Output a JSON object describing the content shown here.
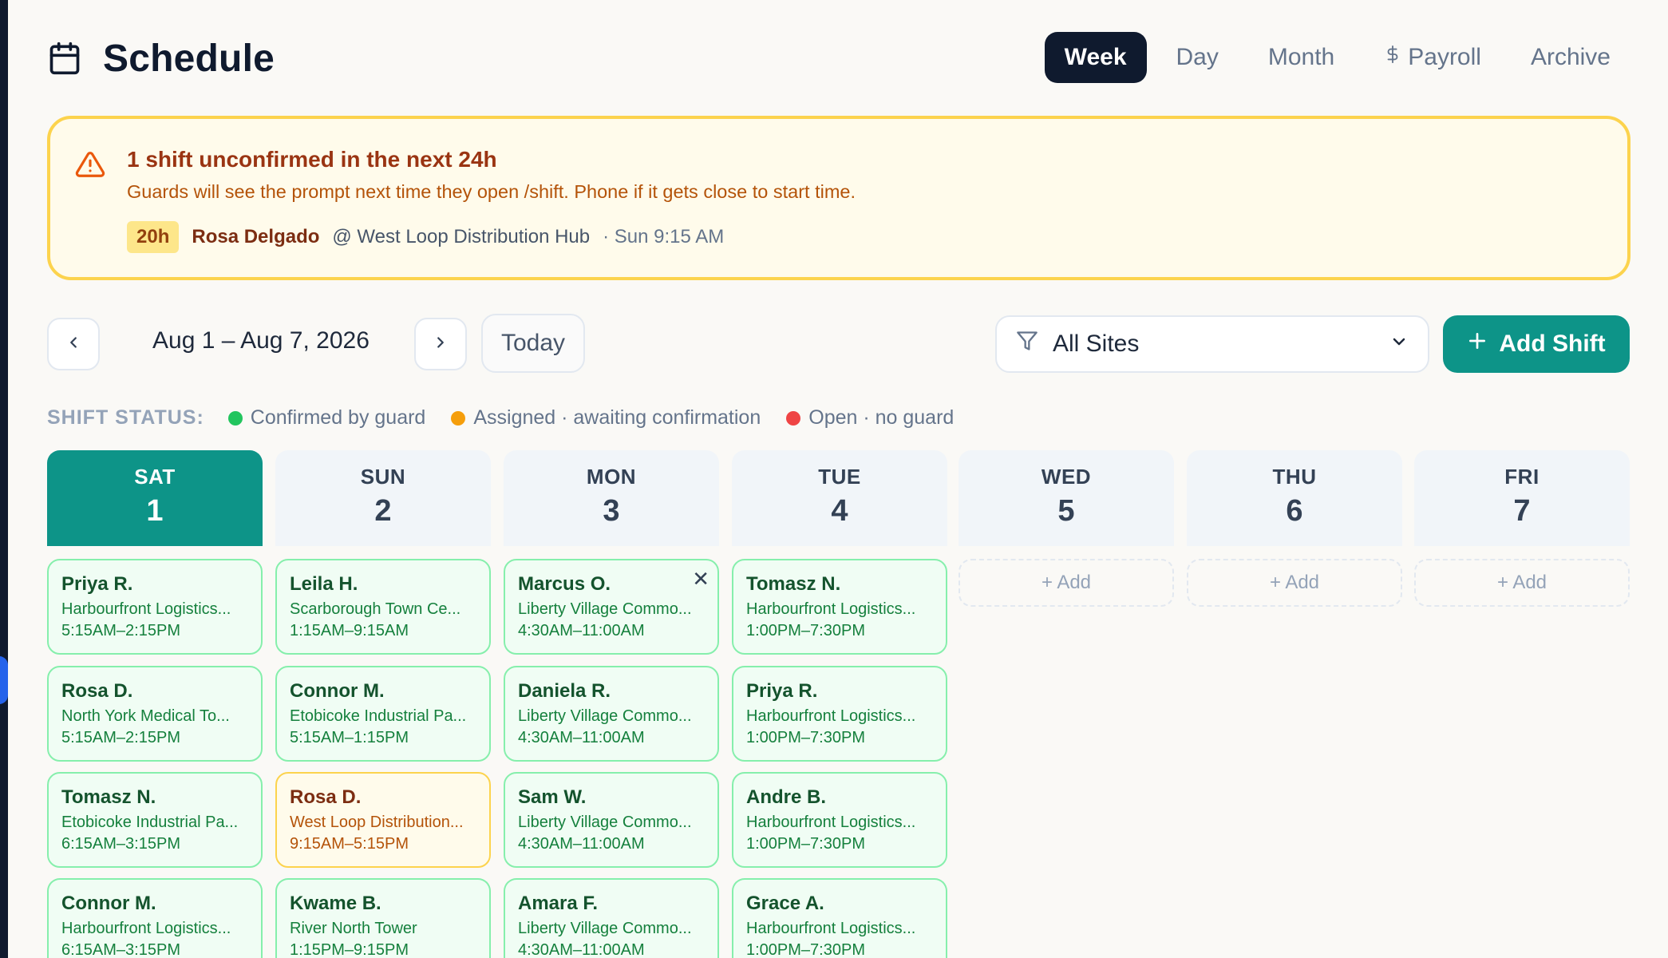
{
  "header": {
    "title": "Schedule",
    "tabs": [
      {
        "label": "Week",
        "active": true
      },
      {
        "label": "Day"
      },
      {
        "label": "Month"
      },
      {
        "label": "Payroll",
        "icon": "dollar-icon"
      },
      {
        "label": "Archive"
      }
    ]
  },
  "alert": {
    "title": "1 shift unconfirmed in the next 24h",
    "text": "Guards will see the prompt next time they open /shift. Phone if it gets close to start time.",
    "badge": "20h",
    "name": "Rosa Delgado",
    "site": "@ West Loop Distribution Hub",
    "time": "· Sun 9:15 AM"
  },
  "toolbar": {
    "range": "Aug 1 – Aug 7, 2026",
    "today_label": "Today",
    "site_filter": "All Sites",
    "add_label": "Add Shift"
  },
  "legend": {
    "title": "SHIFT STATUS:",
    "items": [
      {
        "label": "Confirmed by guard",
        "color": "#22c55e"
      },
      {
        "label": "Assigned · awaiting confirmation",
        "color": "#f59e0b"
      },
      {
        "label": "Open · no guard",
        "color": "#ef4444"
      }
    ]
  },
  "days": [
    {
      "name": "SAT",
      "num": "1"
    },
    {
      "name": "SUN",
      "num": "2"
    },
    {
      "name": "MON",
      "num": "3"
    },
    {
      "name": "TUE",
      "num": "4"
    },
    {
      "name": "WED",
      "num": "5"
    },
    {
      "name": "THU",
      "num": "6"
    },
    {
      "name": "FRI",
      "num": "7"
    }
  ],
  "add_label": "+ Add",
  "shifts": {
    "sat": [
      {
        "name": "Priya R.",
        "site": "Harbourfront Logistics...",
        "time": "5:15AM–2:15PM"
      },
      {
        "name": "Rosa D.",
        "site": "North York Medical To...",
        "time": "5:15AM–2:15PM"
      },
      {
        "name": "Tomasz N.",
        "site": "Etobicoke Industrial Pa...",
        "time": "6:15AM–3:15PM"
      },
      {
        "name": "Connor M.",
        "site": "Harbourfront Logistics...",
        "time": "6:15AM–3:15PM"
      }
    ],
    "sun": [
      {
        "name": "Leila H.",
        "site": "Scarborough Town Ce...",
        "time": "1:15AM–9:15AM"
      },
      {
        "name": "Connor M.",
        "site": "Etobicoke Industrial Pa...",
        "time": "5:15AM–1:15PM"
      },
      {
        "name": "Rosa D.",
        "site": "West Loop Distribution...",
        "time": "9:15AM–5:15PM"
      },
      {
        "name": "Kwame B.",
        "site": "River North Tower",
        "time": "1:15PM–9:15PM"
      }
    ],
    "mon": [
      {
        "name": "Marcus O.",
        "site": "Liberty Village Commo...",
        "time": "4:30AM–11:00AM"
      },
      {
        "name": "Daniela R.",
        "site": "Liberty Village Commo...",
        "time": "4:30AM–11:00AM"
      },
      {
        "name": "Sam W.",
        "site": "Liberty Village Commo...",
        "time": "4:30AM–11:00AM"
      },
      {
        "name": "Amara F.",
        "site": "Liberty Village Commo...",
        "time": "4:30AM–11:00AM"
      }
    ],
    "tue": [
      {
        "name": "Tomasz N.",
        "site": "Harbourfront Logistics...",
        "time": "1:00PM–7:30PM"
      },
      {
        "name": "Priya R.",
        "site": "Harbourfront Logistics...",
        "time": "1:00PM–7:30PM"
      },
      {
        "name": "Andre B.",
        "site": "Harbourfront Logistics...",
        "time": "1:00PM–7:30PM"
      },
      {
        "name": "Grace A.",
        "site": "Harbourfront Logistics...",
        "time": "1:00PM–7:30PM"
      }
    ]
  }
}
